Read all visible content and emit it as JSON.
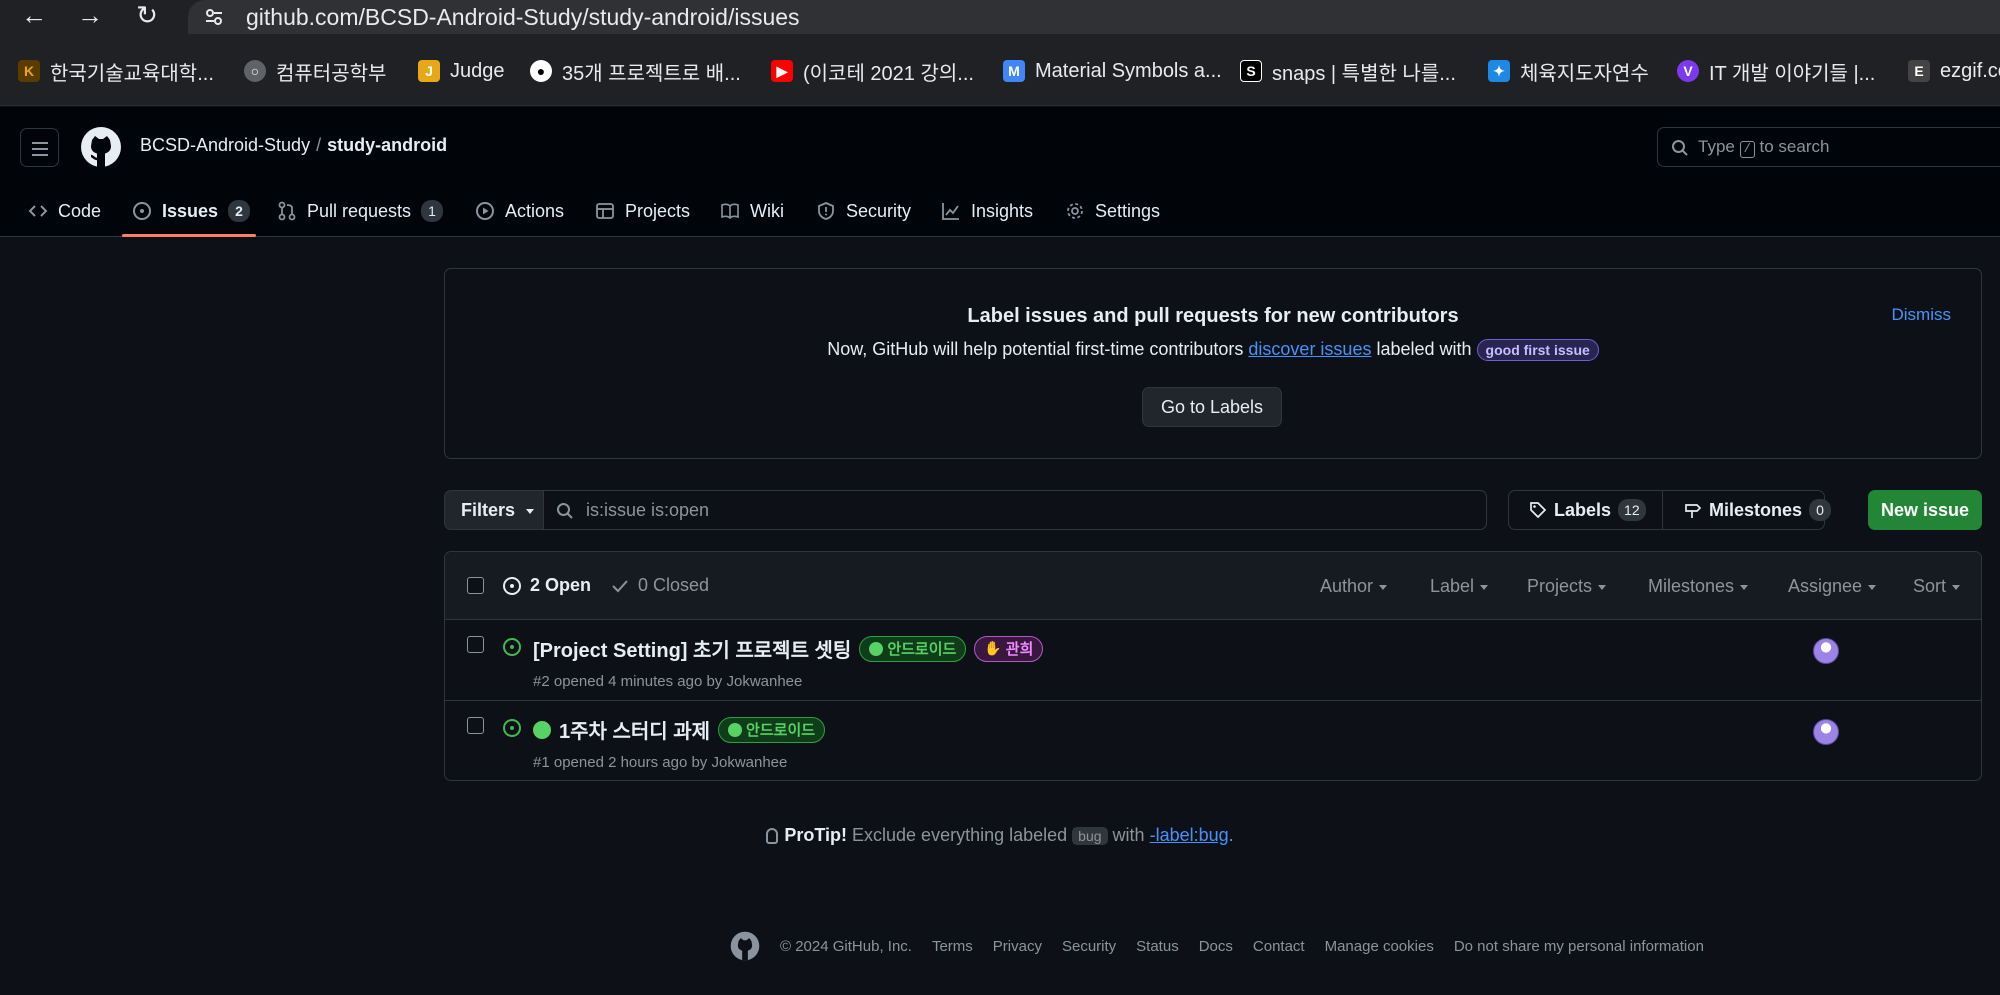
{
  "browser": {
    "url": "github.com/BCSD-Android-Study/study-android/issues",
    "bookmarks": [
      {
        "label": "한국기술교육대학...",
        "icon": "koreatech-icon",
        "color": "#c9a227"
      },
      {
        "label": "컴퓨터공학부",
        "icon": "globe-icon",
        "color": "#8a8f95"
      },
      {
        "label": "Judge",
        "icon": "judge-icon",
        "color": "#e6a817"
      },
      {
        "label": "35개 프로젝트로 배...",
        "icon": "github-icon",
        "color": "#ffffff"
      },
      {
        "label": "(이코테 2021 강의...",
        "icon": "youtube-icon",
        "color": "#ff0000"
      },
      {
        "label": "Material Symbols a...",
        "icon": "material-icon",
        "color": "#4285f4"
      },
      {
        "label": "snaps | 특별한 나를...",
        "icon": "snaps-icon",
        "color": "#000000"
      },
      {
        "label": "체육지도자연수",
        "icon": "sports-icon",
        "color": "#1e88e5"
      },
      {
        "label": "IT 개발 이야기들 |...",
        "icon": "velog-icon",
        "color": "#7c3aed"
      },
      {
        "label": "ezgif.co",
        "icon": "ezgif-icon",
        "color": "#444444"
      }
    ]
  },
  "header": {
    "owner": "BCSD-Android-Study",
    "separator": "/",
    "repo": "study-android",
    "search_placeholder_pre": "Type",
    "search_key": "/",
    "search_placeholder_post": "to search"
  },
  "tabs": [
    {
      "label": "Code"
    },
    {
      "label": "Issues",
      "count": "2"
    },
    {
      "label": "Pull requests",
      "count": "1"
    },
    {
      "label": "Actions"
    },
    {
      "label": "Projects"
    },
    {
      "label": "Wiki"
    },
    {
      "label": "Security"
    },
    {
      "label": "Insights"
    },
    {
      "label": "Settings"
    }
  ],
  "banner": {
    "title": "Label issues and pull requests for new contributors",
    "text_pre": "Now, GitHub will help potential first-time contributors",
    "link": "discover issues",
    "text_post": "labeled with",
    "badge": "good first issue",
    "dismiss": "Dismiss",
    "button": "Go to Labels"
  },
  "filter_bar": {
    "filters_label": "Filters",
    "query": "is:issue is:open",
    "labels_label": "Labels",
    "labels_count": "12",
    "milestones_label": "Milestones",
    "milestones_count": "0",
    "new_issue": "New issue"
  },
  "issues_header": {
    "open": "2 Open",
    "closed": "0 Closed",
    "sort": [
      "Author",
      "Label",
      "Projects",
      "Milestones",
      "Assignee",
      "Sort"
    ]
  },
  "issues": [
    {
      "title": "[Project Setting] 초기 프로젝트 셋팅",
      "labels": [
        "안드로이드",
        "관희"
      ],
      "meta": "#2 opened 4 minutes ago by Jokwanhee"
    },
    {
      "title": "1주차 스터디 과제",
      "labels": [
        "안드로이드"
      ],
      "meta": "#1 opened 2 hours ago by Jokwanhee"
    }
  ],
  "protip": {
    "lead": "ProTip!",
    "text": "Exclude everything labeled",
    "code": "bug",
    "with": "with",
    "link": "-label:bug",
    "end": "."
  },
  "footer": {
    "copyright": "© 2024 GitHub, Inc.",
    "links": [
      "Terms",
      "Privacy",
      "Security",
      "Status",
      "Docs",
      "Contact",
      "Manage cookies",
      "Do not share my personal information"
    ]
  },
  "colors": {
    "accent": "#f78166",
    "link": "#4493f8",
    "open": "#3fb950",
    "primary_button": "#238636"
  }
}
